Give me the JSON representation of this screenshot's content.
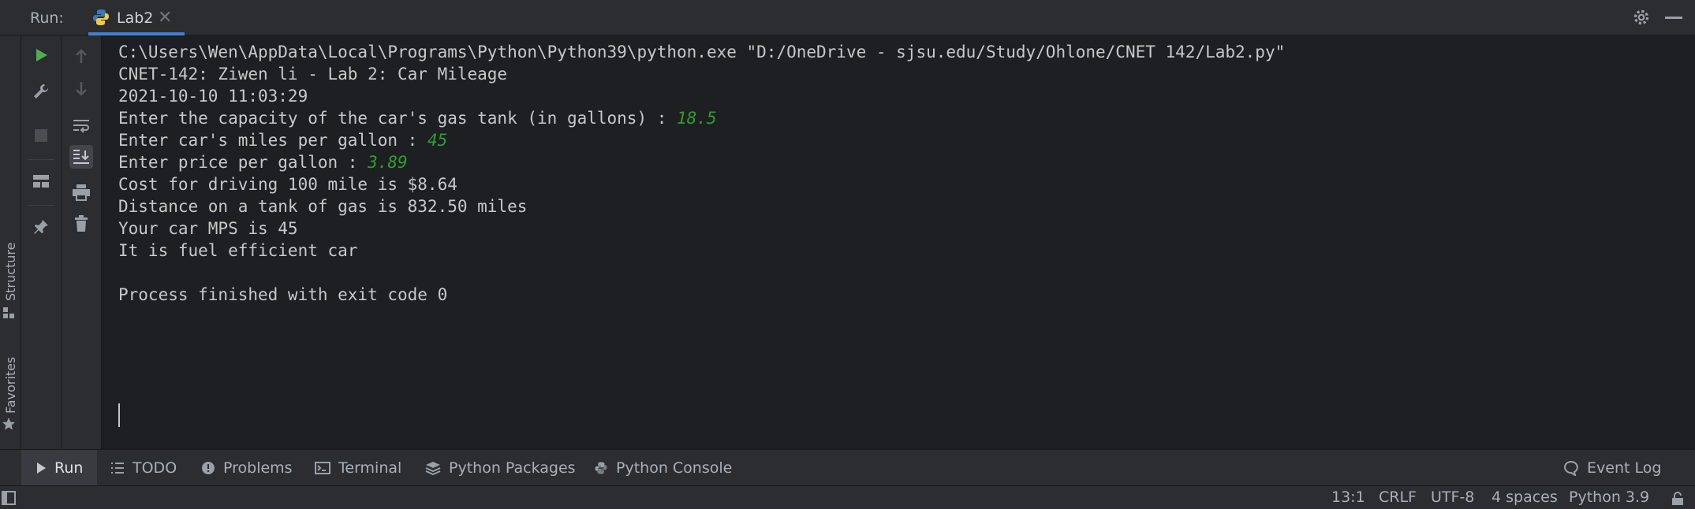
{
  "header": {
    "run_label": "Run:",
    "tab_label": "Lab2",
    "tab_close": "✕"
  },
  "side_panels": {
    "structure_label": "Structure",
    "favorites_label": "Favorites"
  },
  "console": {
    "lines": [
      {
        "text": "C:\\Users\\Wen\\AppData\\Local\\Programs\\Python\\Python39\\python.exe \"D:/OneDrive - sjsu.edu/Study/Ohlone/CNET 142/Lab2.py\""
      },
      {
        "text": "CNET-142: Ziwen li - Lab 2: Car Mileage"
      },
      {
        "text": "2021-10-10 11:03:29"
      },
      {
        "text": "Enter the capacity of the car's gas tank (in gallons) : ",
        "input": "18.5"
      },
      {
        "text": "Enter car's miles per gallon : ",
        "input": "45"
      },
      {
        "text": "Enter price per gallon : ",
        "input": "3.89"
      },
      {
        "text": "Cost for driving 100 mile is $8.64"
      },
      {
        "text": "Distance on a tank of gas is 832.50 miles"
      },
      {
        "text": "Your car MPS is 45"
      },
      {
        "text": "It is fuel efficient car"
      },
      {
        "text": ""
      },
      {
        "text": "Process finished with exit code 0"
      }
    ]
  },
  "bottom_tabs": [
    {
      "label": "Run",
      "icon": "play-icon"
    },
    {
      "label": "TODO",
      "icon": "list-icon"
    },
    {
      "label": "Problems",
      "icon": "info-icon"
    },
    {
      "label": "Terminal",
      "icon": "terminal-icon"
    },
    {
      "label": "Python Packages",
      "icon": "layers-icon"
    },
    {
      "label": "Python Console",
      "icon": "python-icon"
    }
  ],
  "event_log": "Event Log",
  "status": {
    "position": "13:1",
    "line_sep": "CRLF",
    "encoding": "UTF-8",
    "indent": "4 spaces",
    "interpreter": "Python 3.9"
  },
  "colors": {
    "accent": "#3f7fd8",
    "input_text": "#2f9e2f",
    "run_green": "#4caf50"
  }
}
